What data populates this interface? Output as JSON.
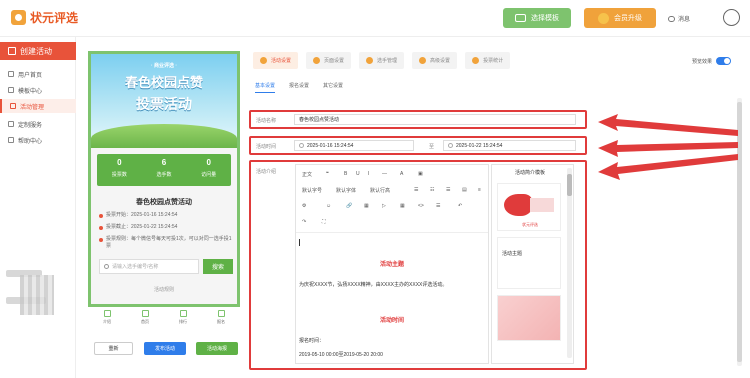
{
  "brand": {
    "name": "状元评选"
  },
  "topbar": {
    "template_btn": "选择模板",
    "vip_btn": "会员升级",
    "message": "消息"
  },
  "sidebar": {
    "create_btn": "创建活动",
    "items": [
      {
        "label": "用户首页"
      },
      {
        "label": "模板中心"
      },
      {
        "label": "活动管理"
      },
      {
        "label": "定制服务"
      },
      {
        "label": "帮助中心"
      }
    ]
  },
  "phone": {
    "banner_small": "· 商业评选 ·",
    "banner_title1": "春色校园点赞",
    "banner_title2": "投票活动",
    "stats": [
      {
        "num": "0",
        "label": "投票数"
      },
      {
        "num": "6",
        "label": "选手数"
      },
      {
        "num": "0",
        "label": "访问量"
      }
    ],
    "name": "春色校园点赞活动",
    "info": [
      {
        "text": "投票开始：2025-01-16 15:24:54"
      },
      {
        "text": "投票截止：2025-01-22 15:24:54"
      },
      {
        "text": "投票规则：每个微信号每天可投1次，可以对同一选手投1票"
      }
    ],
    "search_placeholder": "请输入选手编号/名称",
    "search_btn": "搜索",
    "rules_link": "活动规则",
    "tabs": [
      {
        "label": "介绍"
      },
      {
        "label": "首页"
      },
      {
        "label": "排行"
      },
      {
        "label": "报名"
      }
    ]
  },
  "actions": {
    "reset": "重新",
    "publish": "发布活动",
    "preview": "活动海报"
  },
  "steps": [
    {
      "label": "活动设置"
    },
    {
      "label": "页面设置"
    },
    {
      "label": "选手管理"
    },
    {
      "label": "高级设置"
    },
    {
      "label": "投票统计"
    }
  ],
  "preview_label": "预览效果",
  "subtabs": [
    {
      "label": "基本设置"
    },
    {
      "label": "报名设置"
    },
    {
      "label": "其它设置"
    }
  ],
  "form": {
    "name_label": "活动名称",
    "name_value": "春色校园点赞活动",
    "time_label": "活动时间",
    "time_start": "2025-01-16 15:24:54",
    "time_to": "至",
    "time_end": "2025-01-22 15:24:54",
    "intro_label": "活动介绍"
  },
  "editor": {
    "toolbar": [
      "正文",
      "❝",
      "B",
      "U",
      "I",
      "—",
      "A",
      "▣",
      "默认字号",
      "默认字体",
      "默认行高",
      "☰",
      "☷",
      "☰",
      "▤",
      "≡",
      "⚙",
      "☺",
      "🔗",
      "▦",
      "▷",
      "▦",
      "<>",
      "☰",
      "↶",
      "↷",
      "⛶"
    ],
    "h1": "活动主题",
    "p1": "为庆祝XXXX节，弘扬XXXX精神，由XXXX主办的XXXX评选活动。",
    "h2": "活动时间",
    "p2": "报名时间：",
    "p3": "2019-05-10 00:00至2019-05-20 20:00"
  },
  "template_panel": {
    "title": "活动简介模板",
    "card2_label": "活动主题",
    "card1_caption": "状元评选"
  },
  "colors": {
    "accent_red": "#e03b3b",
    "green": "#5fb146",
    "blue": "#2f7dea",
    "orange": "#f0a23b"
  }
}
